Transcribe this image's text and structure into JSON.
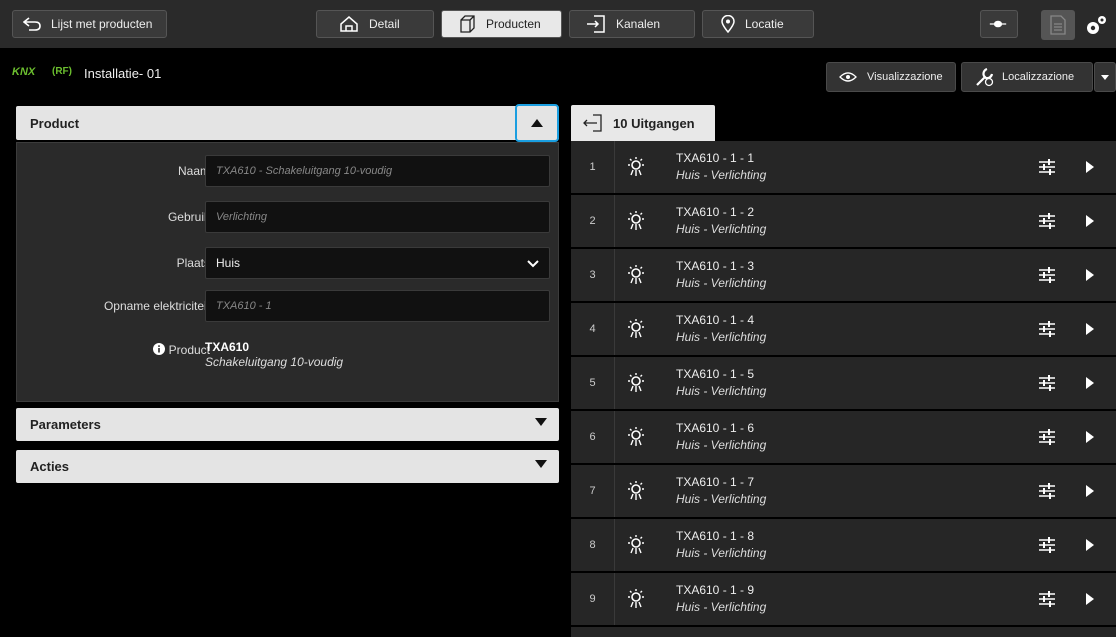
{
  "topbar": {
    "back_label": "Lijst met producten",
    "tabs": [
      {
        "label": "Detail"
      },
      {
        "label": "Producten"
      },
      {
        "label": "Kanalen"
      },
      {
        "label": "Locatie"
      }
    ]
  },
  "header": {
    "knx": "KNX",
    "rf": "(RF)",
    "title": "Installatie- 01",
    "visualizzazione": "Visualizzazione",
    "localizzazione": "Localizzazione"
  },
  "product_panel": {
    "title": "Product",
    "fields": {
      "naam_label": "Naam",
      "naam_placeholder": "TXA610 - Schakeluitgang 10-voudig",
      "gebruik_label": "Gebruik",
      "gebruik_placeholder": "Verlichting",
      "plaats_label": "Plaats",
      "plaats_value": "Huis",
      "opname_label": "Opname elektriciteit",
      "opname_placeholder": "TXA610 - 1"
    },
    "info_label": "Product",
    "info_code": "TXA610",
    "info_desc": "Schakeluitgang 10-voudig"
  },
  "parameters_title": "Parameters",
  "acties_title": "Acties",
  "outputs": {
    "tab_label": "10 Uitgangen",
    "rows": [
      {
        "num": "1",
        "name": "TXA610 - 1 - 1",
        "sub": "Huis - Verlichting"
      },
      {
        "num": "2",
        "name": "TXA610 - 1 - 2",
        "sub": "Huis - Verlichting"
      },
      {
        "num": "3",
        "name": "TXA610 - 1 - 3",
        "sub": "Huis - Verlichting"
      },
      {
        "num": "4",
        "name": "TXA610 - 1 - 4",
        "sub": "Huis - Verlichting"
      },
      {
        "num": "5",
        "name": "TXA610 - 1 - 5",
        "sub": "Huis - Verlichting"
      },
      {
        "num": "6",
        "name": "TXA610 - 1 - 6",
        "sub": "Huis - Verlichting"
      },
      {
        "num": "7",
        "name": "TXA610 - 1 - 7",
        "sub": "Huis - Verlichting"
      },
      {
        "num": "8",
        "name": "TXA610 - 1 - 8",
        "sub": "Huis - Verlichting"
      },
      {
        "num": "9",
        "name": "TXA610 - 1 - 9",
        "sub": "Huis - Verlichting"
      }
    ]
  }
}
